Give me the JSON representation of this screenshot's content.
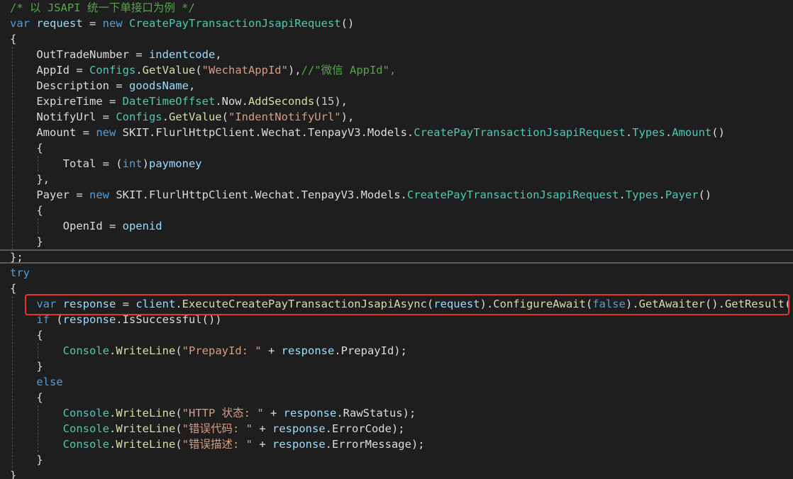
{
  "editor": {
    "language": "C#",
    "theme_colors": {
      "background": "#1e1e1e",
      "comment": "#57a64a",
      "keyword": "#569cd6",
      "type": "#4ec9b0",
      "method": "#dcdcaa",
      "local": "#9cdcfe",
      "string": "#d69d85",
      "number": "#b5cea8",
      "plain": "#dcdcdc",
      "highlight_box": "#e8322a"
    },
    "lines": [
      [
        [
          "/* 以 JSAPI 统一下单接口为例 */",
          "cm"
        ]
      ],
      [
        [
          "var",
          "kw"
        ],
        [
          " ",
          "pl"
        ],
        [
          "request",
          "lv"
        ],
        [
          " = ",
          "pl"
        ],
        [
          "new",
          "kw"
        ],
        [
          " ",
          "pl"
        ],
        [
          "CreatePayTransactionJsapiRequest",
          "ty"
        ],
        [
          "()",
          "pl"
        ]
      ],
      [
        [
          "{",
          "pl"
        ]
      ],
      [
        [
          "    OutTradeNumber = ",
          "pl"
        ],
        [
          "indentcode",
          "lv"
        ],
        [
          ",",
          "pl"
        ]
      ],
      [
        [
          "    AppId = ",
          "pl"
        ],
        [
          "Configs",
          "ty"
        ],
        [
          ".",
          "pl"
        ],
        [
          "GetValue",
          "fn"
        ],
        [
          "(",
          "pl"
        ],
        [
          "\"WechatAppId\"",
          "st"
        ],
        [
          "),",
          "pl"
        ],
        [
          "//\"微信 AppId\",",
          "cm"
        ]
      ],
      [
        [
          "    Description = ",
          "pl"
        ],
        [
          "goodsName",
          "lv"
        ],
        [
          ",",
          "pl"
        ]
      ],
      [
        [
          "    ExpireTime = ",
          "pl"
        ],
        [
          "DateTimeOffset",
          "ty"
        ],
        [
          ".Now.",
          "pl"
        ],
        [
          "AddSeconds",
          "fn"
        ],
        [
          "(",
          "pl"
        ],
        [
          "15",
          "nm"
        ],
        [
          "),",
          "pl"
        ]
      ],
      [
        [
          "    NotifyUrl = ",
          "pl"
        ],
        [
          "Configs",
          "ty"
        ],
        [
          ".",
          "pl"
        ],
        [
          "GetValue",
          "fn"
        ],
        [
          "(",
          "pl"
        ],
        [
          "\"IndentNotifyUrl\"",
          "st"
        ],
        [
          "),",
          "pl"
        ]
      ],
      [
        [
          "    Amount = ",
          "pl"
        ],
        [
          "new",
          "kw"
        ],
        [
          " SKIT.FlurlHttpClient.Wechat.TenpayV3.Models.",
          "pl"
        ],
        [
          "CreatePayTransactionJsapiRequest",
          "ty"
        ],
        [
          ".",
          "pl"
        ],
        [
          "Types",
          "ty"
        ],
        [
          ".",
          "pl"
        ],
        [
          "Amount",
          "ty"
        ],
        [
          "()",
          "pl"
        ]
      ],
      [
        [
          "    {",
          "pl"
        ]
      ],
      [
        [
          "        Total = (",
          "pl"
        ],
        [
          "int",
          "kw"
        ],
        [
          ")",
          "pl"
        ],
        [
          "paymoney",
          "lv"
        ]
      ],
      [
        [
          "    },",
          "pl"
        ]
      ],
      [
        [
          "    Payer = ",
          "pl"
        ],
        [
          "new",
          "kw"
        ],
        [
          " SKIT.FlurlHttpClient.Wechat.TenpayV3.Models.",
          "pl"
        ],
        [
          "CreatePayTransactionJsapiRequest",
          "ty"
        ],
        [
          ".",
          "pl"
        ],
        [
          "Types",
          "ty"
        ],
        [
          ".",
          "pl"
        ],
        [
          "Payer",
          "ty"
        ],
        [
          "()",
          "pl"
        ]
      ],
      [
        [
          "    {",
          "pl"
        ]
      ],
      [
        [
          "        OpenId = ",
          "pl"
        ],
        [
          "openid",
          "lv"
        ]
      ],
      [
        [
          "    }",
          "pl"
        ]
      ],
      [
        [
          "};",
          "pl"
        ]
      ],
      [
        [
          "try",
          "kw"
        ]
      ],
      [
        [
          "{",
          "pl"
        ]
      ],
      [
        [
          "    ",
          "pl"
        ],
        [
          "var",
          "kw"
        ],
        [
          " ",
          "pl"
        ],
        [
          "response",
          "lv"
        ],
        [
          " = ",
          "pl"
        ],
        [
          "client",
          "lv"
        ],
        [
          ".",
          "pl"
        ],
        [
          "ExecuteCreatePayTransactionJsapiAsync",
          "fn"
        ],
        [
          "(",
          "pl"
        ],
        [
          "request",
          "lv"
        ],
        [
          ").",
          "pl"
        ],
        [
          "ConfigureAwait",
          "fn"
        ],
        [
          "(",
          "pl"
        ],
        [
          "false",
          "kw"
        ],
        [
          ").",
          "pl"
        ],
        [
          "GetAwaiter",
          "fn"
        ],
        [
          "().",
          "pl"
        ],
        [
          "GetResult",
          "fn"
        ],
        [
          "();",
          "pl"
        ]
      ],
      [
        [
          "    ",
          "pl"
        ],
        [
          "if",
          "kw"
        ],
        [
          " (",
          "pl"
        ],
        [
          "response",
          "lv"
        ],
        [
          ".IsSuccessful())",
          "pl"
        ]
      ],
      [
        [
          "    {",
          "pl"
        ]
      ],
      [
        [
          "        ",
          "pl"
        ],
        [
          "Console",
          "ty"
        ],
        [
          ".",
          "pl"
        ],
        [
          "WriteLine",
          "fn"
        ],
        [
          "(",
          "pl"
        ],
        [
          "\"PrepayId: \"",
          "st"
        ],
        [
          " + ",
          "pl"
        ],
        [
          "response",
          "lv"
        ],
        [
          ".PrepayId);",
          "pl"
        ]
      ],
      [
        [
          "    }",
          "pl"
        ]
      ],
      [
        [
          "    ",
          "pl"
        ],
        [
          "else",
          "kw"
        ]
      ],
      [
        [
          "    {",
          "pl"
        ]
      ],
      [
        [
          "        ",
          "pl"
        ],
        [
          "Console",
          "ty"
        ],
        [
          ".",
          "pl"
        ],
        [
          "WriteLine",
          "fn"
        ],
        [
          "(",
          "pl"
        ],
        [
          "\"HTTP 状态: \"",
          "st"
        ],
        [
          " + ",
          "pl"
        ],
        [
          "response",
          "lv"
        ],
        [
          ".RawStatus);",
          "pl"
        ]
      ],
      [
        [
          "        ",
          "pl"
        ],
        [
          "Console",
          "ty"
        ],
        [
          ".",
          "pl"
        ],
        [
          "WriteLine",
          "fn"
        ],
        [
          "(",
          "pl"
        ],
        [
          "\"错误代码: \"",
          "st"
        ],
        [
          " + ",
          "pl"
        ],
        [
          "response",
          "lv"
        ],
        [
          ".ErrorCode);",
          "pl"
        ]
      ],
      [
        [
          "        ",
          "pl"
        ],
        [
          "Console",
          "ty"
        ],
        [
          ".",
          "pl"
        ],
        [
          "WriteLine",
          "fn"
        ],
        [
          "(",
          "pl"
        ],
        [
          "\"错误描述: \"",
          "st"
        ],
        [
          " + ",
          "pl"
        ],
        [
          "response",
          "lv"
        ],
        [
          ".ErrorMessage);",
          "pl"
        ]
      ],
      [
        [
          "    }",
          "pl"
        ]
      ],
      [
        [
          "}",
          "pl"
        ]
      ]
    ]
  }
}
